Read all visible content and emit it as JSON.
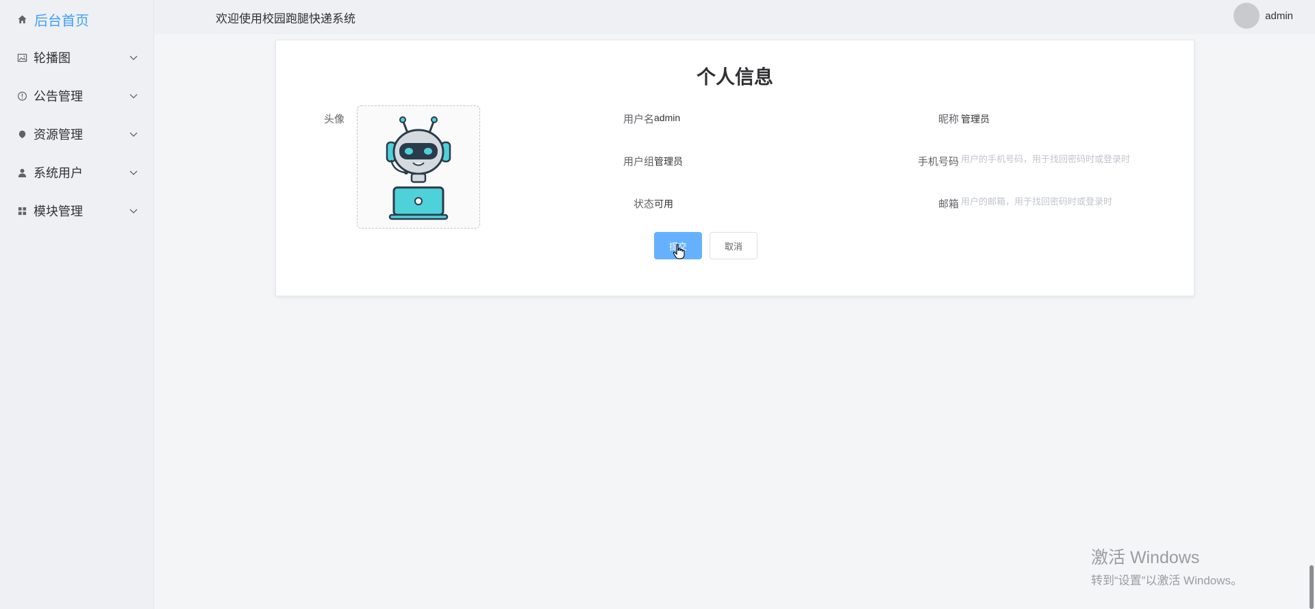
{
  "app": {
    "welcome": "欢迎使用校园跑腿快递系统"
  },
  "user": {
    "name": "admin"
  },
  "sidebar": {
    "home": {
      "label": "后台首页",
      "icon": "home-icon"
    },
    "items": [
      {
        "label": "轮播图",
        "icon": "picture-icon"
      },
      {
        "label": "公告管理",
        "icon": "info-icon"
      },
      {
        "label": "资源管理",
        "icon": "resource-icon"
      },
      {
        "label": "系统用户",
        "icon": "user-icon"
      },
      {
        "label": "模块管理",
        "icon": "grid-icon"
      }
    ]
  },
  "profile": {
    "title": "个人信息",
    "avatar_label": "头像",
    "fields": {
      "username": {
        "label": "用户名",
        "value": "admin"
      },
      "nickname": {
        "label": "昵称",
        "value": "管理员"
      },
      "usergroup": {
        "label": "用户组",
        "value": "管理员"
      },
      "phone": {
        "label": "手机号码",
        "value": "",
        "placeholder": "用户的手机号码，用于找回密码时或登录时"
      },
      "status": {
        "label": "状态",
        "value": "可用"
      },
      "email": {
        "label": "邮箱",
        "value": "",
        "placeholder": "用户的邮箱，用于找回密码时或登录时"
      }
    },
    "submit_label": "提交",
    "cancel_label": "取消"
  },
  "watermark": {
    "title": "激活 Windows",
    "subtitle": "转到“设置”以激活 Windows。"
  },
  "colors": {
    "accent": "#409eff",
    "primary_button": "#66b1ff",
    "sidebar_bg": "#eef0f3"
  }
}
